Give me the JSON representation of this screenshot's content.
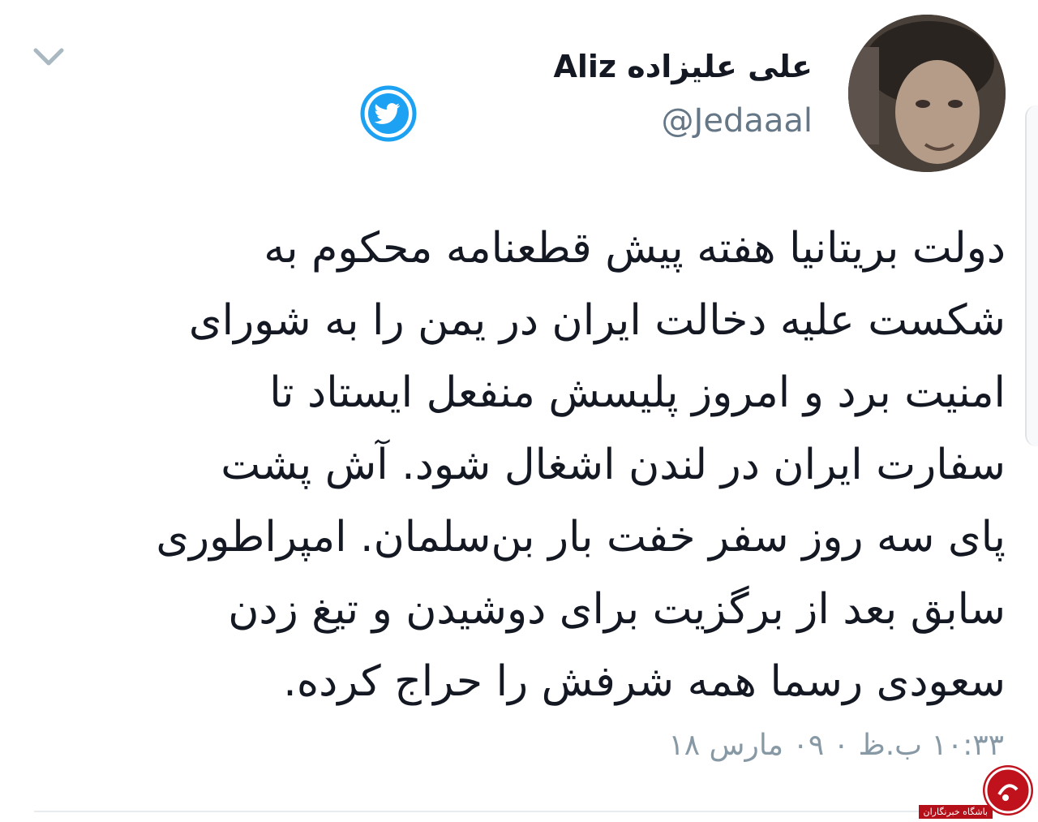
{
  "header": {
    "display_name": "علی علیزاده Aliz",
    "handle": "@Jedaaal",
    "menu_icon": "chevron-down-icon",
    "badge_icon": "twitter-bird-icon"
  },
  "tweet": {
    "lines": [
      "دولت بریتانیا هفته پیش قطعنامه محکوم به",
      "شکست علیه دخالت ایران در یمن را به شورای",
      "امنیت برد و امروز پلیسش منفعل ایستاد تا",
      "سفارت ایران در لندن اشغال شود. آش پشت",
      "پای سه روز سفر خفت بار بن‌سلمان. امپراطوری",
      "سابق بعد از برگزیت برای دوشیدن و تیغ زدن",
      "سعودی رسما همه شرفش را حراج کرده."
    ],
    "timestamp": "۱۰:۳۳ ب.ظ ۰ ۰۹ مارس ۱۸"
  },
  "watermark": {
    "label": "باشگاه خبرنگاران"
  },
  "colors": {
    "text": "#141823",
    "secondary": "#657786",
    "twitter_blue": "#1da1f2",
    "divider": "#e6ecf0",
    "watermark_red": "#c0121c"
  }
}
